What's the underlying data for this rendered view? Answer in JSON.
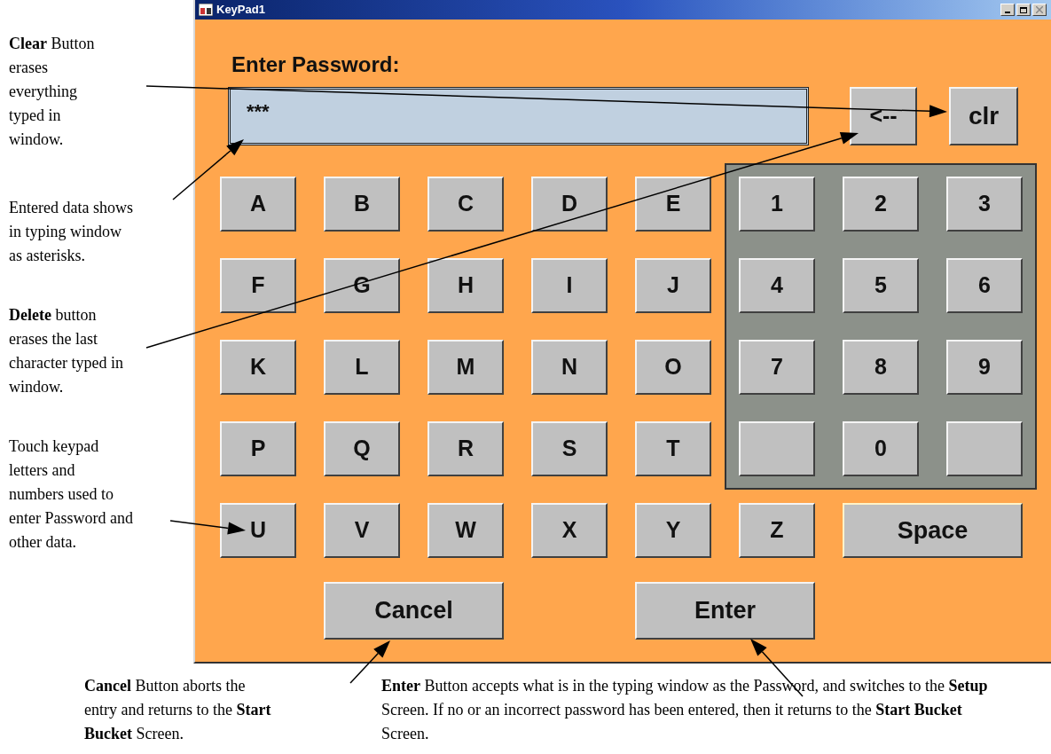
{
  "window": {
    "title": "KeyPad1"
  },
  "prompt": "Enter Password:",
  "password_field": {
    "value": "***"
  },
  "backspace_button": "<--",
  "clear_button": "clr",
  "letter_keys": [
    "A",
    "B",
    "C",
    "D",
    "E",
    "F",
    "G",
    "H",
    "I",
    "J",
    "K",
    "L",
    "M",
    "N",
    "O",
    "P",
    "Q",
    "R",
    "S",
    "T",
    "U",
    "V",
    "W",
    "X",
    "Y",
    "Z"
  ],
  "number_keys": [
    {
      "kind": "key",
      "label": "1"
    },
    {
      "kind": "key",
      "label": "2"
    },
    {
      "kind": "key",
      "label": "3"
    },
    {
      "kind": "key",
      "label": "4"
    },
    {
      "kind": "key",
      "label": "5"
    },
    {
      "kind": "key",
      "label": "6"
    },
    {
      "kind": "key",
      "label": "7"
    },
    {
      "kind": "key",
      "label": "8"
    },
    {
      "kind": "key",
      "label": "9"
    },
    {
      "kind": "blank"
    },
    {
      "kind": "key",
      "label": "0"
    },
    {
      "kind": "blank"
    }
  ],
  "space_key": "Space",
  "cancel_button": "Cancel",
  "enter_button": "Enter",
  "side_notes": [
    "**Clear** Button erases everything typed in window.",
    "Entered data shows in typing window as asterisks.",
    "**Delete** button erases the last character typed in window.",
    "Touch keypad letters and numbers used to enter Password and other data."
  ],
  "bottom_notes": [
    "**Cancel** Button aborts the entry and returns to the **Start Bucket** Screen.",
    "**Enter** Button accepts what is in the typing window as the Password, and switches to the **Setup** Screen. If no or an incorrect password has been entered, then it returns to the **Start Bucket** Screen."
  ]
}
